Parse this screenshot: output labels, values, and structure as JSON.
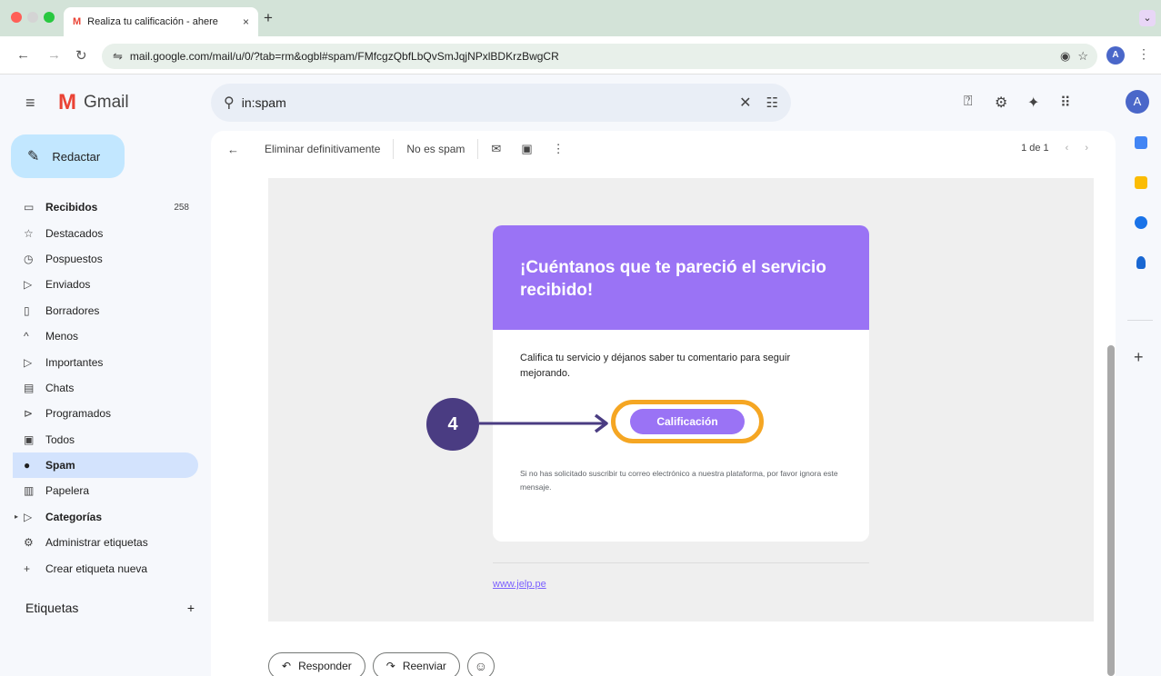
{
  "browser": {
    "tab_title": "Realiza tu calificación - ahere",
    "tab_close": "×",
    "new_tab": "+",
    "tab_menu": "⌄",
    "url": "mail.google.com/mail/u/0/?tab=rm&ogbl#spam/FMfcgzQbfLbQvSmJqjNPxlBDKrzBwgCR",
    "profile_initial": "A"
  },
  "gmail": {
    "logo_text": "Gmail",
    "search_value": "in:spam",
    "avatar_initial": "A",
    "compose_label": "Redactar"
  },
  "sidebar": {
    "items": [
      {
        "label": "Recibidos",
        "count": "258"
      },
      {
        "label": "Destacados",
        "count": ""
      },
      {
        "label": "Pospuestos",
        "count": ""
      },
      {
        "label": "Enviados",
        "count": ""
      },
      {
        "label": "Borradores",
        "count": ""
      },
      {
        "label": "Menos",
        "count": ""
      },
      {
        "label": "Importantes",
        "count": ""
      },
      {
        "label": "Chats",
        "count": ""
      },
      {
        "label": "Programados",
        "count": ""
      },
      {
        "label": "Todos",
        "count": ""
      },
      {
        "label": "Spam",
        "count": ""
      },
      {
        "label": "Papelera",
        "count": ""
      },
      {
        "label": "Categorías",
        "count": ""
      },
      {
        "label": "Administrar etiquetas",
        "count": ""
      },
      {
        "label": "Crear etiqueta nueva",
        "count": ""
      }
    ],
    "labels_heading": "Etiquetas",
    "labels_add": "+"
  },
  "mail_toolbar": {
    "delete_forever": "Eliminar definitivamente",
    "not_spam": "No es spam",
    "pager": "1 de 1"
  },
  "email": {
    "heading": "¡Cuéntanos que te pareció el servicio recibido!",
    "body": "Califica tu servicio y déjanos saber tu comentario para seguir mejorando.",
    "cta_label": "Calificación",
    "footer": "Si no has solicitado suscribir tu correo electrónico a nuestra plataforma, por favor ignora este mensaje.",
    "link": "www.jelp.pe"
  },
  "annotation": {
    "step_number": "4",
    "highlight_color": "#f5a623",
    "marker_color": "#4a3c82"
  },
  "actions": {
    "reply": "Responder",
    "forward": "Reenviar"
  },
  "colors": {
    "accent_purple": "#9a73f5",
    "nav_active": "#d3e3fd",
    "compose_bg": "#c2e7ff"
  }
}
